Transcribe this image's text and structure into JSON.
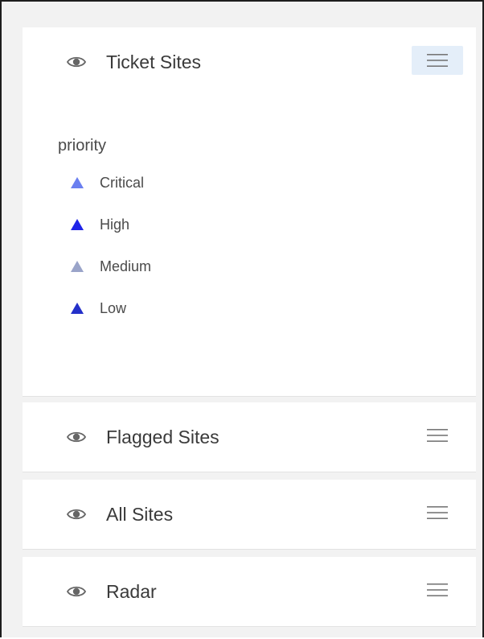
{
  "layers": [
    {
      "title": "Ticket Sites",
      "expanded": true,
      "menu_active": true,
      "eye_icon": "eye-icon",
      "menu_icon": "hamburger-menu-icon"
    },
    {
      "title": "Flagged Sites",
      "expanded": false,
      "menu_active": false,
      "eye_icon": "eye-icon",
      "menu_icon": "hamburger-menu-icon"
    },
    {
      "title": "All Sites",
      "expanded": false,
      "menu_active": false,
      "eye_icon": "eye-icon",
      "menu_icon": "hamburger-menu-icon"
    },
    {
      "title": "Radar",
      "expanded": false,
      "menu_active": false,
      "eye_icon": "eye-icon",
      "menu_icon": "hamburger-menu-icon"
    }
  ],
  "legend": {
    "field": "priority",
    "items": [
      {
        "label": "Critical",
        "color": "#6a7ff0",
        "icon": "triangle-icon"
      },
      {
        "label": "High",
        "color": "#1f24e8",
        "icon": "triangle-icon"
      },
      {
        "label": "Medium",
        "color": "#9aa4c9",
        "icon": "triangle-icon"
      },
      {
        "label": "Low",
        "color": "#2430c9",
        "icon": "triangle-icon"
      }
    ]
  },
  "colors": {
    "menu_active_bg": "#e4eef9",
    "icon_gray": "#666666",
    "panel_bg": "#ffffff",
    "gap_bg": "#f2f2f2"
  }
}
